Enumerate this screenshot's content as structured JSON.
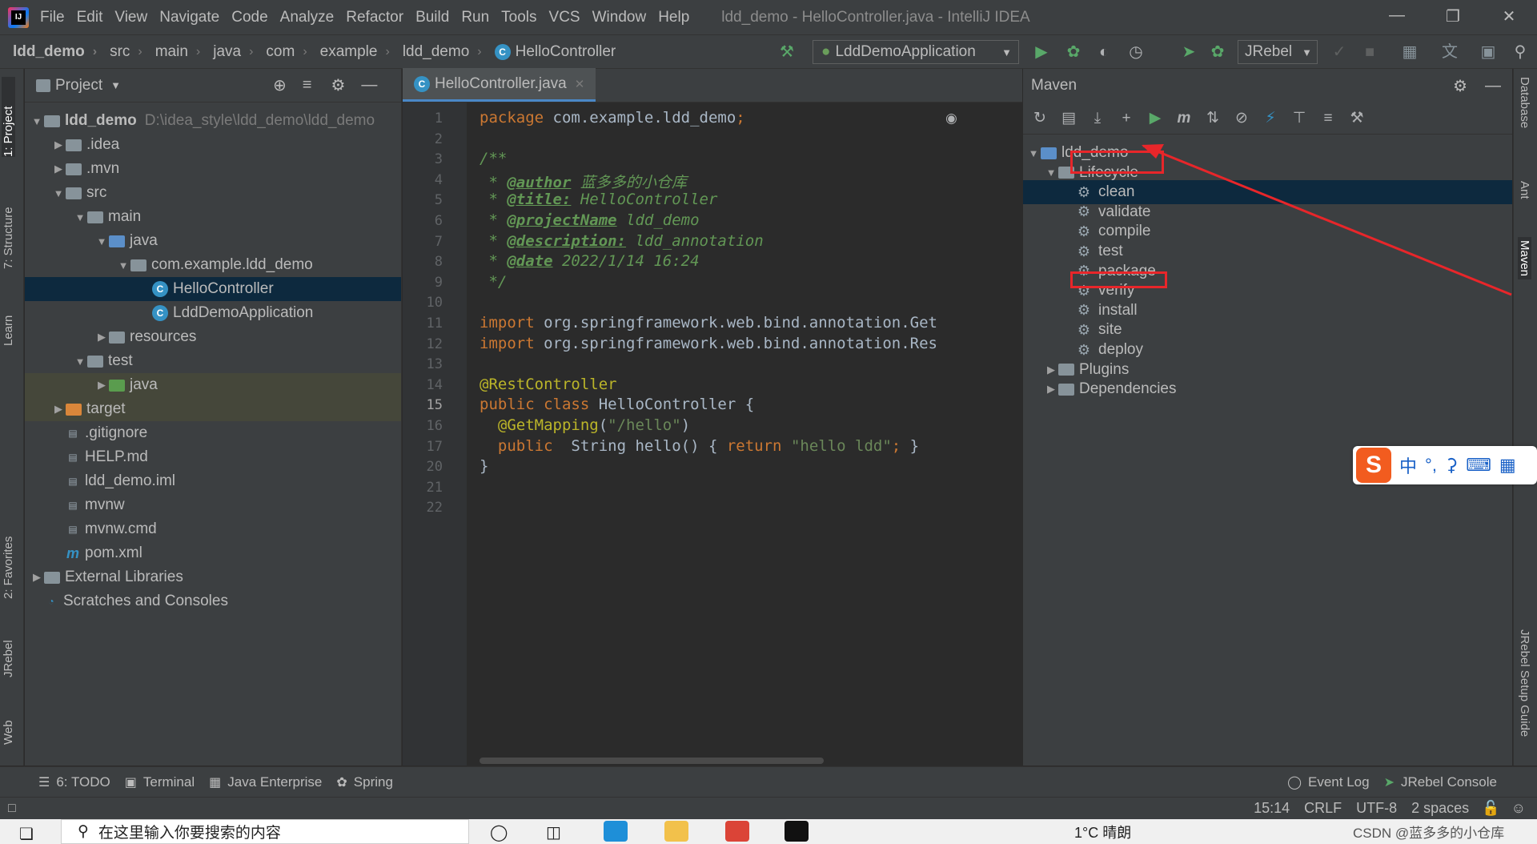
{
  "menu": {
    "items": [
      "File",
      "Edit",
      "View",
      "Navigate",
      "Code",
      "Analyze",
      "Refactor",
      "Build",
      "Run",
      "Tools",
      "VCS",
      "Window",
      "Help"
    ],
    "window_title": "ldd_demo - HelloController.java - IntelliJ IDEA",
    "logo_text": "IJ"
  },
  "navbar": {
    "breadcrumbs": [
      "ldd_demo",
      "src",
      "main",
      "java",
      "com",
      "example",
      "ldd_demo",
      "HelloController"
    ],
    "run_config": "LddDemoApplication",
    "jrebel_label": "JRebel"
  },
  "left_stripe": {
    "tabs": [
      "1: Project",
      "7: Structure",
      "Learn",
      "2: Favorites",
      "JRebel",
      "Web"
    ]
  },
  "project": {
    "header": "Project",
    "tree": [
      {
        "label": "ldd_demo",
        "path": "D:\\idea_style\\ldd_demo\\ldd_demo",
        "icon": "module-folder",
        "expanded": true
      },
      {
        "label": ".idea",
        "icon": "folder",
        "expanded": false
      },
      {
        "label": ".mvn",
        "icon": "folder",
        "expanded": false
      },
      {
        "label": "src",
        "icon": "folder",
        "expanded": true
      },
      {
        "label": "main",
        "icon": "folder",
        "expanded": true
      },
      {
        "label": "java",
        "icon": "source-folder",
        "expanded": true
      },
      {
        "label": "com.example.ldd_demo",
        "icon": "package",
        "expanded": true
      },
      {
        "label": "HelloController",
        "icon": "class",
        "selected": true
      },
      {
        "label": "LddDemoApplication",
        "icon": "spring-class"
      },
      {
        "label": "resources",
        "icon": "resources-folder",
        "expanded": false
      },
      {
        "label": "test",
        "icon": "folder",
        "expanded": true
      },
      {
        "label": "java",
        "icon": "test-folder",
        "expanded": false
      },
      {
        "label": "target",
        "icon": "excluded-folder",
        "expanded": false
      },
      {
        "label": ".gitignore",
        "icon": "file"
      },
      {
        "label": "HELP.md",
        "icon": "md-file"
      },
      {
        "label": "ldd_demo.iml",
        "icon": "iml-file"
      },
      {
        "label": "mvnw",
        "icon": "script-file"
      },
      {
        "label": "mvnw.cmd",
        "icon": "cmd-file"
      },
      {
        "label": "pom.xml",
        "icon": "maven-file"
      },
      {
        "label": "External Libraries",
        "icon": "libraries",
        "expanded": false
      },
      {
        "label": "Scratches and Consoles",
        "icon": "scratches"
      }
    ]
  },
  "editor": {
    "tab": "HelloController.java",
    "line_numbers": [
      "1",
      "2",
      "3",
      "4",
      "5",
      "6",
      "7",
      "8",
      "9",
      "10",
      "11",
      "12",
      "13",
      "14",
      "15",
      "16",
      "17",
      "20",
      "21",
      "22"
    ],
    "current_line": "15",
    "lines": [
      {
        "parts": [
          {
            "t": "package ",
            "c": "kw"
          },
          {
            "t": "com.example.ldd_demo",
            "c": ""
          },
          {
            "t": ";",
            "c": "kw"
          }
        ]
      },
      {
        "parts": []
      },
      {
        "parts": [
          {
            "t": "/**",
            "c": "cm"
          }
        ]
      },
      {
        "parts": [
          {
            "t": " * ",
            "c": "cm"
          },
          {
            "t": "@author",
            "c": "tag"
          },
          {
            "t": " 蓝多多的小仓库",
            "c": "cm"
          }
        ]
      },
      {
        "parts": [
          {
            "t": " * ",
            "c": "cm"
          },
          {
            "t": "@title:",
            "c": "tag"
          },
          {
            "t": " HelloController",
            "c": "cm"
          }
        ]
      },
      {
        "parts": [
          {
            "t": " * ",
            "c": "cm"
          },
          {
            "t": "@projectName",
            "c": "tag"
          },
          {
            "t": " ldd_demo",
            "c": "cm"
          }
        ]
      },
      {
        "parts": [
          {
            "t": " * ",
            "c": "cm"
          },
          {
            "t": "@description:",
            "c": "tag"
          },
          {
            "t": " ldd_annotation",
            "c": "cm"
          }
        ]
      },
      {
        "parts": [
          {
            "t": " * ",
            "c": "cm"
          },
          {
            "t": "@date",
            "c": "tag"
          },
          {
            "t": " 2022/1/14 16:24",
            "c": "cm"
          }
        ]
      },
      {
        "parts": [
          {
            "t": " */",
            "c": "cm"
          }
        ]
      },
      {
        "parts": []
      },
      {
        "parts": [
          {
            "t": "import ",
            "c": "kw"
          },
          {
            "t": "org.springframework.web.bind.annotation.Get",
            "c": ""
          }
        ]
      },
      {
        "parts": [
          {
            "t": "import ",
            "c": "kw"
          },
          {
            "t": "org.springframework.web.bind.annotation.Res",
            "c": ""
          }
        ]
      },
      {
        "parts": []
      },
      {
        "parts": [
          {
            "t": "@RestController",
            "c": "ann"
          }
        ]
      },
      {
        "parts": [
          {
            "t": "public class ",
            "c": "kw"
          },
          {
            "t": "HelloController {",
            "c": ""
          }
        ]
      },
      {
        "parts": [
          {
            "t": "  @GetMapping",
            "c": "ann"
          },
          {
            "t": "(",
            "c": ""
          },
          {
            "t": "\"/hello\"",
            "c": "str"
          },
          {
            "t": ")",
            "c": ""
          }
        ]
      },
      {
        "parts": [
          {
            "t": "  public  ",
            "c": "kw"
          },
          {
            "t": "String hello() { ",
            "c": ""
          },
          {
            "t": "return ",
            "c": "kw"
          },
          {
            "t": "\"hello ldd\"",
            "c": "str"
          },
          {
            "t": "; ",
            "c": "kw"
          },
          {
            "t": "}",
            "c": ""
          }
        ]
      },
      {
        "parts": [
          {
            "t": "}",
            "c": ""
          }
        ]
      },
      {
        "parts": []
      },
      {
        "parts": []
      }
    ]
  },
  "maven": {
    "header": "Maven",
    "tree": [
      {
        "label": "ldd_demo",
        "level": 0,
        "expanded": true
      },
      {
        "label": "Lifecycle",
        "level": 1,
        "expanded": true
      },
      {
        "label": "clean",
        "level": 2,
        "selected": true
      },
      {
        "label": "validate",
        "level": 2
      },
      {
        "label": "compile",
        "level": 2
      },
      {
        "label": "test",
        "level": 2
      },
      {
        "label": "package",
        "level": 2
      },
      {
        "label": "verify",
        "level": 2
      },
      {
        "label": "install",
        "level": 2
      },
      {
        "label": "site",
        "level": 2
      },
      {
        "label": "deploy",
        "level": 2
      },
      {
        "label": "Plugins",
        "level": 1,
        "expanded": false
      },
      {
        "label": "Dependencies",
        "level": 1,
        "expanded": false
      }
    ]
  },
  "right_stripe": {
    "tabs": [
      "Database",
      "Ant",
      "Maven",
      "JRebel Setup Guide"
    ]
  },
  "bottom_tools": {
    "left": [
      "6: TODO",
      "Terminal",
      "Java Enterprise",
      "Spring"
    ],
    "right": [
      "Event Log",
      "JRebel Console"
    ]
  },
  "status": {
    "position": "15:14",
    "line_sep": "CRLF",
    "encoding": "UTF-8",
    "indent": "2 spaces"
  },
  "ime": {
    "logo": "S",
    "mode": "中"
  },
  "taskbar": {
    "search_placeholder": "在这里输入你要搜索的内容",
    "weather": "1°C 晴朗",
    "watermark": "CSDN @蓝多多的小仓库"
  }
}
